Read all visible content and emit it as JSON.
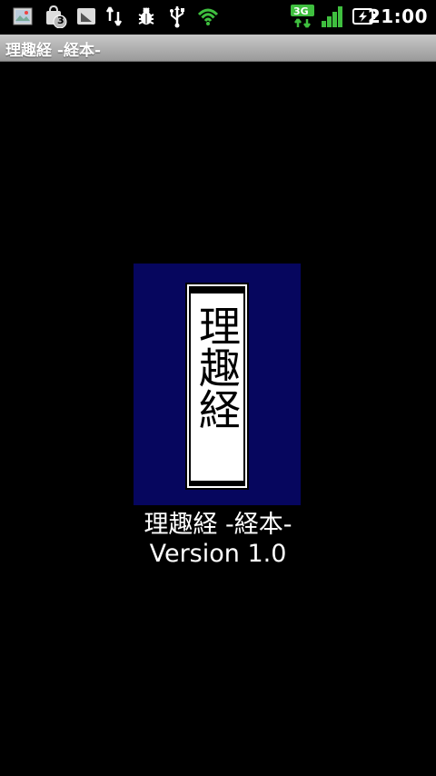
{
  "status_bar": {
    "notification_count": "3",
    "network_type": "3G",
    "time": "21:00",
    "icons": [
      "image-icon",
      "shopping-bag-icon",
      "download-icon",
      "usb-icon",
      "bug-icon",
      "usb-alt-icon",
      "wifi-icon",
      "network-3g-icon",
      "signal-icon",
      "battery-charging-icon"
    ]
  },
  "title_bar": {
    "title": "理趣経 -経本-"
  },
  "cover": {
    "title": "理趣経",
    "background_color": "#06065e"
  },
  "app_info": {
    "name": "理趣経 -経本-",
    "version": "Version 1.0"
  }
}
